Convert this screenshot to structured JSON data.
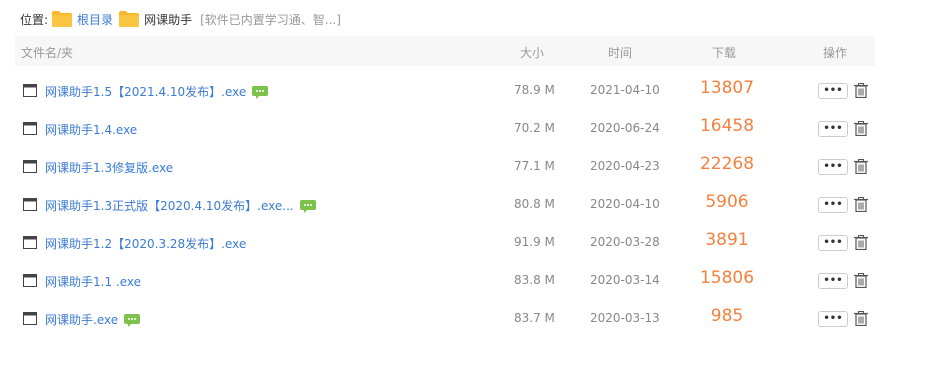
{
  "breadcrumb": {
    "label": "位置:",
    "root": "根目录",
    "current": "网课助手",
    "extra": "[软件已内置学习通、智...]"
  },
  "table": {
    "headers": {
      "name": "文件名/夹",
      "size": "大小",
      "time": "时间",
      "downloads": "下载",
      "actions": "操作"
    },
    "rows": [
      {
        "name": "网课助手1.5【2021.4.10发布】.exe",
        "size": "78.9 M",
        "date": "2021-04-10",
        "downloads": "13807",
        "has_comment": true
      },
      {
        "name": "网课助手1.4.exe",
        "size": "70.2 M",
        "date": "2020-06-24",
        "downloads": "16458",
        "has_comment": false
      },
      {
        "name": "网课助手1.3修复版.exe",
        "size": "77.1 M",
        "date": "2020-04-23",
        "downloads": "22268",
        "has_comment": false
      },
      {
        "name": "网课助手1.3正式版【2020.4.10发布】.exe...",
        "size": "80.8 M",
        "date": "2020-04-10",
        "downloads": "5906",
        "has_comment": true
      },
      {
        "name": "网课助手1.2【2020.3.28发布】.exe",
        "size": "91.9 M",
        "date": "2020-03-28",
        "downloads": "3891",
        "has_comment": false
      },
      {
        "name": "网课助手1.1 .exe",
        "size": "83.8 M",
        "date": "2020-03-14",
        "downloads": "15806",
        "has_comment": false
      },
      {
        "name": "网课助手.exe",
        "size": "83.7 M",
        "date": "2020-03-13",
        "downloads": "985",
        "has_comment": true
      }
    ],
    "more_label": "•••"
  },
  "colors": {
    "link": "#3b7bd4",
    "downloads": "#f5803e",
    "folder": "#f9b72a",
    "comment_icon": "#7cc24b"
  },
  "icons": {
    "folder": "folder-icon",
    "file": "window-file-icon",
    "comment": "comment-icon",
    "more": "more-options-icon",
    "delete": "trash-icon"
  }
}
